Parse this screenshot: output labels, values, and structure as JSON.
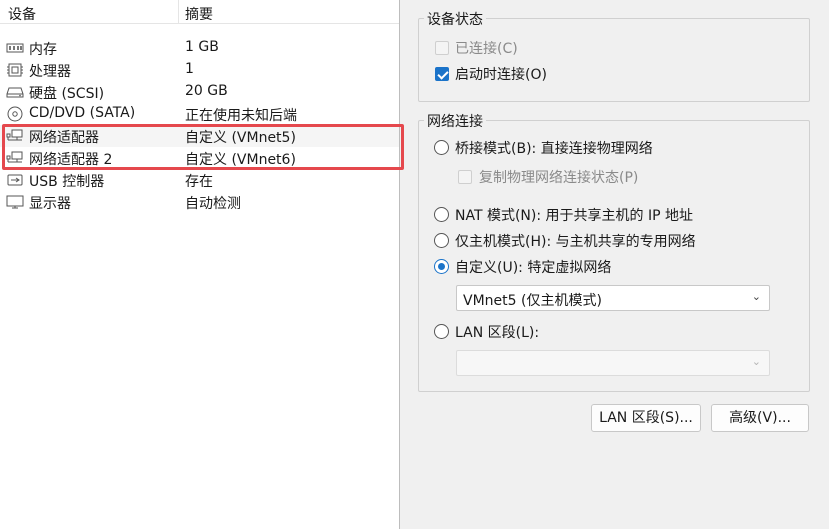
{
  "devices": {
    "header": {
      "device": "设备",
      "summary": "摘要"
    },
    "rows": [
      {
        "name": "内存",
        "summary": "1 GB",
        "icon": "memory-icon"
      },
      {
        "name": "处理器",
        "summary": "1",
        "icon": "processor-icon"
      },
      {
        "name": "硬盘 (SCSI)",
        "summary": "20 GB",
        "icon": "hard-disk-icon"
      },
      {
        "name": "CD/DVD (SATA)",
        "summary": "正在使用未知后端",
        "icon": "cd-dvd-icon"
      },
      {
        "name": "网络适配器",
        "summary": "自定义 (VMnet5)",
        "icon": "network-adapter-icon"
      },
      {
        "name": "网络适配器 2",
        "summary": "自定义 (VMnet6)",
        "icon": "network-adapter-icon"
      },
      {
        "name": "USB 控制器",
        "summary": "存在",
        "icon": "usb-icon"
      },
      {
        "name": "显示器",
        "summary": "自动检测",
        "icon": "display-icon"
      }
    ]
  },
  "device_status": {
    "title": "设备状态",
    "connected": {
      "label": "已连接(C)",
      "checked": false,
      "enabled": false
    },
    "connect_on_power_on": {
      "label": "启动时连接(O)",
      "checked": true,
      "enabled": true
    }
  },
  "network_connection": {
    "title": "网络连接",
    "bridged": {
      "label": "桥接模式(B): 直接连接物理网络",
      "selected": false
    },
    "replicate": {
      "label": "复制物理网络连接状态(P)",
      "checked": false,
      "enabled": false
    },
    "nat": {
      "label": "NAT 模式(N): 用于共享主机的 IP 地址",
      "selected": false
    },
    "host_only": {
      "label": "仅主机模式(H): 与主机共享的专用网络",
      "selected": false
    },
    "custom": {
      "label": "自定义(U): 特定虚拟网络",
      "selected": true
    },
    "custom_select_value": "VMnet5 (仅主机模式)",
    "lan_segment": {
      "label": "LAN 区段(L):",
      "selected": false
    },
    "lan_select_value": ""
  },
  "buttons": {
    "lan_segments": "LAN 区段(S)...",
    "advanced": "高级(V)..."
  },
  "colors": {
    "accent": "#1a73c9",
    "highlight": "#e5484d"
  }
}
